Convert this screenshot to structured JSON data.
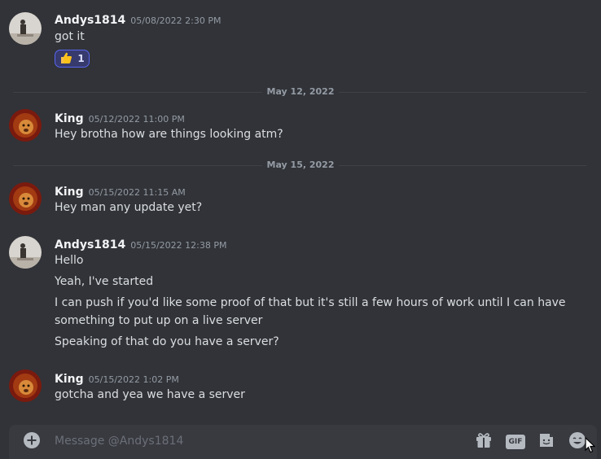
{
  "messages": [
    {
      "author": "Andys1814",
      "timestamp": "05/08/2022 2:30 PM",
      "lines": [
        "got it"
      ],
      "reaction": {
        "emoji": "thumbs-up",
        "count": "1"
      }
    },
    {
      "author": "King",
      "timestamp": "05/12/2022 11:00 PM",
      "lines": [
        "Hey brotha how are things looking atm?"
      ]
    },
    {
      "author": "King",
      "timestamp": "05/15/2022 11:15 AM",
      "lines": [
        "Hey man any update yet?"
      ]
    },
    {
      "author": "Andys1814",
      "timestamp": "05/15/2022 12:38 PM",
      "lines": [
        "Hello",
        "Yeah, I've started",
        "I can push if you'd like some proof of that but it's still a few hours of work until I can have",
        "something to put up on a live server",
        "Speaking of that do you have a server?"
      ]
    },
    {
      "author": "King",
      "timestamp": "05/15/2022 1:02 PM",
      "lines": [
        "gotcha and yea we have a server"
      ]
    }
  ],
  "dividers": [
    "May 12, 2022",
    "May 15, 2022"
  ],
  "composer": {
    "placeholder": "Message @Andys1814",
    "icons": [
      "add-icon",
      "gift-icon",
      "gif-icon",
      "sticker-icon",
      "emoji-icon"
    ],
    "gif_label": "GIF"
  },
  "colors": {
    "background": "#313338",
    "composer": "#383a40",
    "reaction_border": "#5865f2",
    "author": "#f2f3f5",
    "timestamp": "#949ba4"
  }
}
